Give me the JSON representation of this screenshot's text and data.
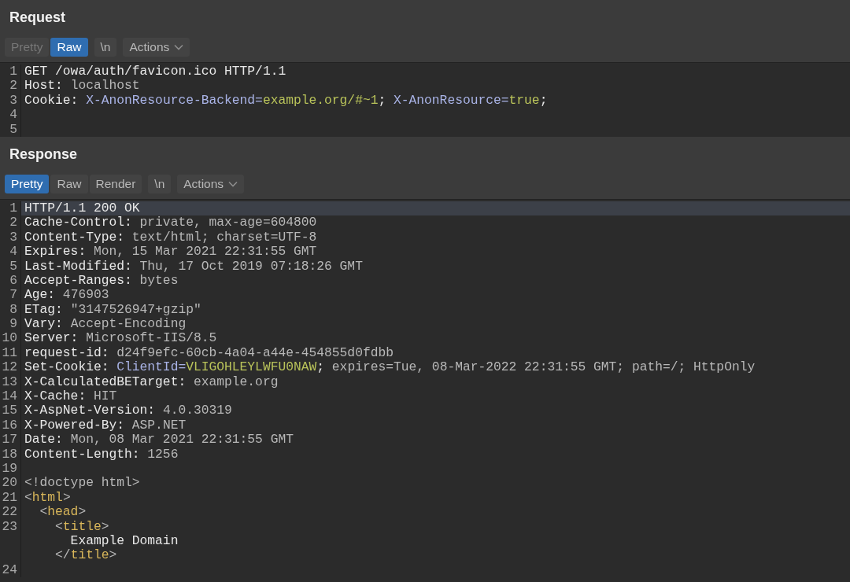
{
  "panels": [
    {
      "title": "Request",
      "tabs": [
        {
          "label": "Pretty",
          "kind": "tab",
          "selected": false,
          "disabled": true
        },
        {
          "label": "Raw",
          "kind": "tab",
          "selected": true,
          "disabled": false
        },
        {
          "label": "\\n",
          "kind": "toggle",
          "selected": false,
          "disabled": false
        },
        {
          "label": "Actions",
          "kind": "dropdown",
          "selected": false,
          "disabled": false
        }
      ],
      "lines": [
        {
          "num": "1",
          "highlighted": false,
          "segments": [
            {
              "kind": "text",
              "text": "GET /owa/auth/favicon.ico HTTP/1.1"
            }
          ]
        },
        {
          "num": "2",
          "highlighted": false,
          "segments": [
            {
              "kind": "text",
              "text": "Host: "
            },
            {
              "kind": "value",
              "text": "localhost"
            }
          ]
        },
        {
          "num": "3",
          "highlighted": false,
          "segments": [
            {
              "kind": "text",
              "text": "Cookie: "
            },
            {
              "kind": "name",
              "text": "X-AnonResource-Backend="
            },
            {
              "kind": "val",
              "text": "example.org/#~1"
            },
            {
              "kind": "text",
              "text": "; "
            },
            {
              "kind": "name",
              "text": "X-AnonResource="
            },
            {
              "kind": "val",
              "text": "true"
            },
            {
              "kind": "text",
              "text": ";"
            }
          ]
        },
        {
          "num": "4",
          "highlighted": false
        },
        {
          "num": "5",
          "highlighted": false
        }
      ]
    },
    {
      "title": "Response",
      "tabs": [
        {
          "label": "Pretty",
          "kind": "tab",
          "selected": true,
          "disabled": false
        },
        {
          "label": "Raw",
          "kind": "tab",
          "selected": false,
          "disabled": false
        },
        {
          "label": "Render",
          "kind": "tab",
          "selected": false,
          "disabled": false
        },
        {
          "label": "\\n",
          "kind": "toggle",
          "selected": false,
          "disabled": false
        },
        {
          "label": "Actions",
          "kind": "dropdown",
          "selected": false,
          "disabled": false
        }
      ],
      "lines": [
        {
          "num": "1",
          "highlighted": true,
          "segments": [
            {
              "kind": "text",
              "text": "HTTP/1.1 200 OK"
            }
          ]
        },
        {
          "num": "2",
          "highlighted": false,
          "segments": [
            {
              "kind": "text",
              "text": "Cache-Control: "
            },
            {
              "kind": "value",
              "text": "private, max-age=604800"
            }
          ]
        },
        {
          "num": "3",
          "highlighted": false,
          "segments": [
            {
              "kind": "text",
              "text": "Content-Type: "
            },
            {
              "kind": "value",
              "text": "text/html; charset=UTF-8"
            }
          ]
        },
        {
          "num": "4",
          "highlighted": false,
          "segments": [
            {
              "kind": "text",
              "text": "Expires: "
            },
            {
              "kind": "value",
              "text": "Mon, 15 Mar 2021 22:31:55 GMT"
            }
          ]
        },
        {
          "num": "5",
          "highlighted": false,
          "segments": [
            {
              "kind": "text",
              "text": "Last-Modified: "
            },
            {
              "kind": "value",
              "text": "Thu, 17 Oct 2019 07:18:26 GMT"
            }
          ]
        },
        {
          "num": "6",
          "highlighted": false,
          "segments": [
            {
              "kind": "text",
              "text": "Accept-Ranges: "
            },
            {
              "kind": "value",
              "text": "bytes"
            }
          ]
        },
        {
          "num": "7",
          "highlighted": false,
          "segments": [
            {
              "kind": "text",
              "text": "Age: "
            },
            {
              "kind": "value",
              "text": "476903"
            }
          ]
        },
        {
          "num": "8",
          "highlighted": false,
          "segments": [
            {
              "kind": "text",
              "text": "ETag: "
            },
            {
              "kind": "value",
              "text": "\"3147526947+gzip\""
            }
          ]
        },
        {
          "num": "9",
          "highlighted": false,
          "segments": [
            {
              "kind": "text",
              "text": "Vary: "
            },
            {
              "kind": "value",
              "text": "Accept-Encoding"
            }
          ]
        },
        {
          "num": "10",
          "highlighted": false,
          "segments": [
            {
              "kind": "text",
              "text": "Server: "
            },
            {
              "kind": "value",
              "text": "Microsoft-IIS/8.5"
            }
          ]
        },
        {
          "num": "11",
          "highlighted": false,
          "segments": [
            {
              "kind": "text",
              "text": "request-id: "
            },
            {
              "kind": "value",
              "text": "d24f9efc-60cb-4a04-a44e-454855d0fdbb"
            }
          ]
        },
        {
          "num": "12",
          "highlighted": false,
          "segments": [
            {
              "kind": "text",
              "text": "Set-Cookie: "
            },
            {
              "kind": "name",
              "text": "ClientId="
            },
            {
              "kind": "val",
              "text": "VLIGOHLEYLWFU0NAW"
            },
            {
              "kind": "text",
              "text": "; "
            },
            {
              "kind": "value",
              "text": "expires=Tue, 08-Mar-2022 22:31:55 GMT; path=/; HttpOnly"
            }
          ]
        },
        {
          "num": "13",
          "highlighted": false,
          "segments": [
            {
              "kind": "text",
              "text": "X-CalculatedBETarget: "
            },
            {
              "kind": "value",
              "text": "example.org"
            }
          ]
        },
        {
          "num": "14",
          "highlighted": false,
          "segments": [
            {
              "kind": "text",
              "text": "X-Cache: "
            },
            {
              "kind": "value",
              "text": "HIT"
            }
          ]
        },
        {
          "num": "15",
          "highlighted": false,
          "segments": [
            {
              "kind": "text",
              "text": "X-AspNet-Version: "
            },
            {
              "kind": "value",
              "text": "4.0.30319"
            }
          ]
        },
        {
          "num": "16",
          "highlighted": false,
          "segments": [
            {
              "kind": "text",
              "text": "X-Powered-By: "
            },
            {
              "kind": "value",
              "text": "ASP.NET"
            }
          ]
        },
        {
          "num": "17",
          "highlighted": false,
          "segments": [
            {
              "kind": "text",
              "text": "Date: "
            },
            {
              "kind": "value",
              "text": "Mon, 08 Mar 2021 22:31:55 GMT"
            }
          ]
        },
        {
          "num": "18",
          "highlighted": false,
          "segments": [
            {
              "kind": "text",
              "text": "Content-Length: "
            },
            {
              "kind": "value",
              "text": "1256"
            }
          ]
        },
        {
          "num": "19",
          "highlighted": false
        },
        {
          "num": "20",
          "highlighted": false,
          "segments": [
            {
              "kind": "value",
              "text": "<!doctype html>"
            }
          ]
        },
        {
          "num": "21",
          "highlighted": false,
          "segments": [
            {
              "kind": "value",
              "text": "<"
            },
            {
              "kind": "tag",
              "text": "html"
            },
            {
              "kind": "value",
              "text": ">"
            }
          ]
        },
        {
          "num": "22",
          "highlighted": false,
          "segments": [
            {
              "kind": "value",
              "text": "  <"
            },
            {
              "kind": "tag",
              "text": "head"
            },
            {
              "kind": "value",
              "text": ">"
            }
          ]
        },
        {
          "num": "23",
          "highlighted": false,
          "segments": [
            {
              "kind": "value",
              "text": "    <"
            },
            {
              "kind": "tag",
              "text": "title"
            },
            {
              "kind": "value",
              "text": ">"
            }
          ]
        },
        {
          "highlighted": false,
          "segments": [
            {
              "kind": "text",
              "text": "      Example Domain"
            }
          ]
        },
        {
          "highlighted": false,
          "segments": [
            {
              "kind": "value",
              "text": "    </"
            },
            {
              "kind": "tag",
              "text": "title"
            },
            {
              "kind": "value",
              "text": ">"
            }
          ]
        },
        {
          "num": "24",
          "highlighted": false
        }
      ]
    }
  ]
}
